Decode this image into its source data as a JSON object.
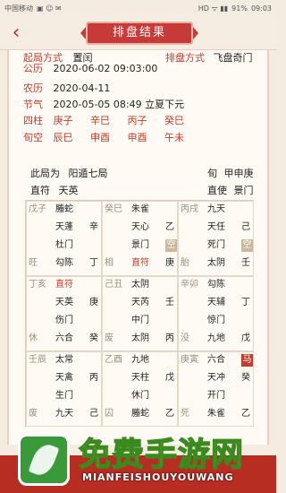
{
  "status": {
    "carrier": "中国移动",
    "signal": "HD ᯤ ▮▮",
    "battery": "91%",
    "time": "09:03"
  },
  "header": {
    "title": "排盘结果",
    "back_icon": "‹"
  },
  "info": {
    "qiju": {
      "label": "起局方式",
      "value": "置闰",
      "label2": "排盘方式",
      "value2": "飞盘奇门"
    },
    "gongli": {
      "label": "公历",
      "value": "2020-06-02 09:03:00"
    },
    "nongli": {
      "label": "农历",
      "value": "2020-04-11"
    },
    "jieqi": {
      "label": "节气",
      "value": "2020-05-05 08:49 立夏下元"
    },
    "sizhu": {
      "label": "四柱",
      "values": [
        "庚子",
        "辛巳",
        "丙子",
        "癸巳"
      ]
    },
    "xunkong": {
      "label": "旬空",
      "values": [
        "辰巳",
        "申酉",
        "申酉",
        "午未"
      ]
    }
  },
  "ju": {
    "ciju_label": "此局为",
    "ciju_value": "阳遁七局",
    "xun_label": "旬",
    "xun_value": "甲申庚",
    "zhifu_label": "直符",
    "zhifu_value": "天英",
    "zhishi_label": "直使",
    "zhishi_value": "景门"
  },
  "grid": [
    {
      "tl": "戊子",
      "l1": "螣蛇",
      "l2": "天蓬",
      "r2": "辛",
      "l3": "杜门",
      "bl": "旺",
      "l4": "勾陈",
      "r4": "丁",
      "r3": ""
    },
    {
      "tl": "癸巳",
      "l1": "朱雀",
      "l2": "天心",
      "r2": "乙",
      "l3": "景门",
      "r3": "空",
      "bl": "相",
      "l4": "直符",
      "r4": "庚"
    },
    {
      "tl": "丙戌",
      "l1": "九天",
      "l2": "天任",
      "r2": "己",
      "l3": "死门",
      "r3": "空",
      "bl": "胎",
      "l4": "太阴",
      "r4": "壬"
    },
    {
      "tl": "丁亥",
      "l1": "直符",
      "l2": "天英",
      "r2": "庚",
      "l3": "伤门",
      "bl": "休",
      "l4": "六合",
      "r4": "癸",
      "r3": ""
    },
    {
      "tl": "己丑",
      "l1": "太阴",
      "l2": "天芮",
      "r2": "壬",
      "l3": "中门",
      "bl": "废",
      "l4": "太阴",
      "r4": "丙",
      "r3": ""
    },
    {
      "tl": "辛卯",
      "l1": "勾陈",
      "l2": "天辅",
      "r2": "丁",
      "l3": "惊门",
      "bl": "没",
      "l4": "九地",
      "r4": "戊",
      "r3": ""
    },
    {
      "tl": "壬辰",
      "l1": "太常",
      "l2": "天禽",
      "r2": "丙",
      "l3": "生门",
      "bl": "废",
      "l4": "九天",
      "r4": "己",
      "r3": ""
    },
    {
      "tl": "乙酉",
      "l1": "九地",
      "l2": "天柱",
      "r2": "戊",
      "l3": "休门",
      "bl": "囚",
      "l4": "螣蛇",
      "r4": "乙",
      "r3": ""
    },
    {
      "tl": "庚寅",
      "l1": "六合",
      "l1b": "马",
      "l2": "天冲",
      "r2": "癸",
      "l3": "开门",
      "bl": "死",
      "l4": "朱雀",
      "r4": "乙",
      "r3": ""
    }
  ],
  "watermark": {
    "title": "免费手游网",
    "sub": "MIANFEISHOUYOUWANG"
  }
}
